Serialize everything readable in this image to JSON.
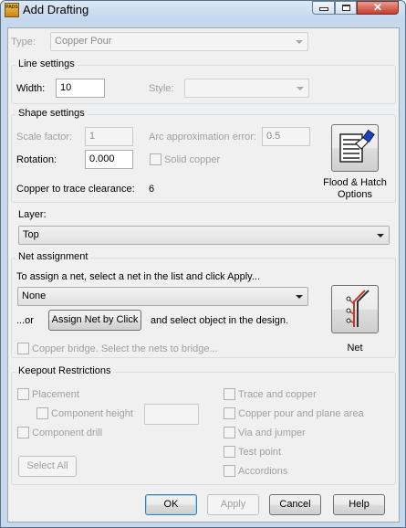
{
  "window": {
    "title": "Add Drafting",
    "app_badge": "PADS"
  },
  "type_row": {
    "label": "Type:",
    "value": "Copper Pour"
  },
  "line_settings": {
    "title": "Line settings",
    "width_label": "Width:",
    "width_value": "10",
    "style_label": "Style:",
    "style_value": ""
  },
  "shape_settings": {
    "title": "Shape settings",
    "scale_label": "Scale factor:",
    "scale_value": "1",
    "arc_label": "Arc approximation error:",
    "arc_value": "0.5",
    "rotation_label": "Rotation:",
    "rotation_value": "0.000",
    "solid_label": "Solid copper",
    "clearance_label": "Copper to trace clearance:",
    "clearance_value": "6",
    "flood_label_1": "Flood & Hatch",
    "flood_label_2": "Options"
  },
  "layer": {
    "label": "Layer:",
    "value": "Top"
  },
  "net_assignment": {
    "title": "Net assignment",
    "instruction": "To assign a net, select a net in the list and click Apply...",
    "net_value": "None",
    "or_label": "...or",
    "assign_button": "Assign Net by Click",
    "after_text": "and select object in the design.",
    "net_button": "Net",
    "bridge_label": "Copper bridge. Select the nets to bridge..."
  },
  "keepout": {
    "title": "Keepout Restrictions",
    "placement": "Placement",
    "component_height": "Component height",
    "component_height_value": "",
    "component_drill": "Component drill",
    "select_all": "Select All",
    "trace_copper": "Trace and copper",
    "copper_pour_plane": "Copper pour and plane area",
    "via_jumper": "Via and jumper",
    "test_point": "Test point",
    "accordions": "Accordions"
  },
  "buttons": {
    "ok": "OK",
    "apply": "Apply",
    "cancel": "Cancel",
    "help": "Help"
  }
}
